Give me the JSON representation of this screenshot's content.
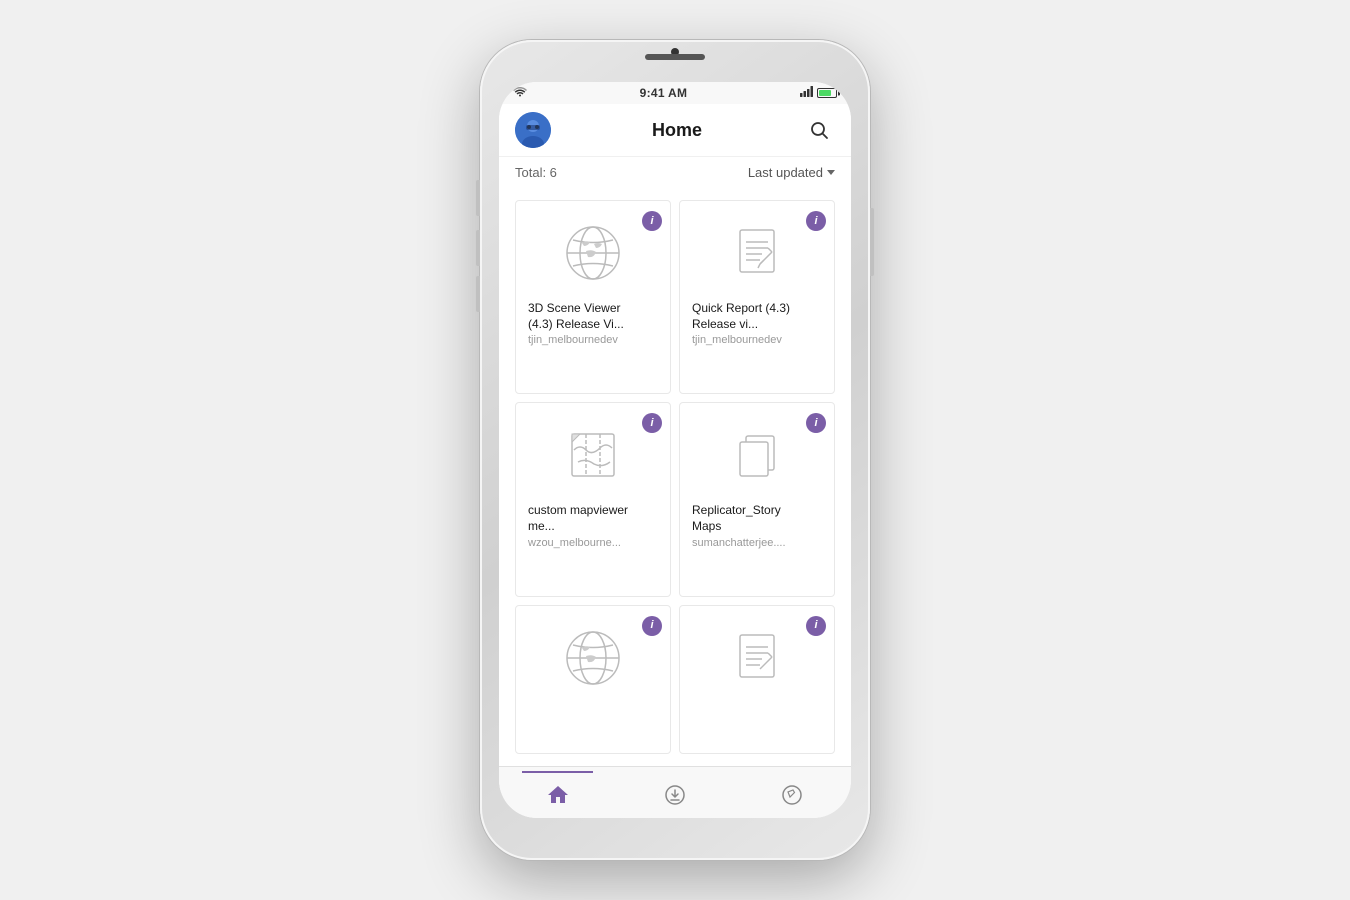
{
  "status_bar": {
    "time": "9:41 AM",
    "wifi": "wifi",
    "battery_level": "75"
  },
  "header": {
    "title": "Home",
    "search_label": "search"
  },
  "sort_bar": {
    "total_label": "Total: 6",
    "sort_option": "Last updated"
  },
  "items": [
    {
      "id": "item1",
      "title": "3D Scene Viewer (4.3) Release Vi...",
      "subtitle": "tjin_melbournedev",
      "type": "globe",
      "info_label": "i"
    },
    {
      "id": "item2",
      "title": "Quick Report (4.3) Release vi...",
      "subtitle": "tjin_melbournedev",
      "type": "report",
      "info_label": "i"
    },
    {
      "id": "item3",
      "title": "custom mapviewer me...",
      "subtitle": "wzou_melbourne...",
      "type": "map",
      "info_label": "i"
    },
    {
      "id": "item4",
      "title": "Replicator_Story Maps",
      "subtitle": "sumanchatterjee....",
      "type": "document",
      "info_label": "i"
    },
    {
      "id": "item5",
      "title": "",
      "subtitle": "",
      "type": "globe",
      "info_label": "i"
    },
    {
      "id": "item6",
      "title": "",
      "subtitle": "",
      "type": "report",
      "info_label": "i"
    }
  ],
  "tabs": [
    {
      "id": "home",
      "label": "Home",
      "active": true
    },
    {
      "id": "download",
      "label": "Download",
      "active": false
    },
    {
      "id": "compass",
      "label": "Compass",
      "active": false
    }
  ]
}
